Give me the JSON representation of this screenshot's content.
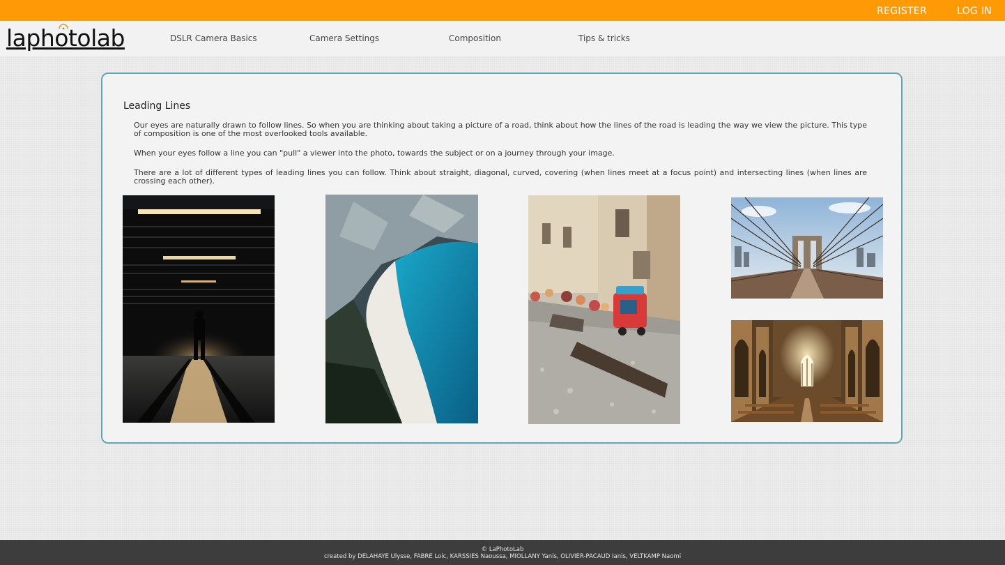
{
  "header": {
    "register_label": "REGISTER",
    "login_label": "LOG IN",
    "accent_color": "#ff9a05"
  },
  "nav": {
    "logo_text": "laphotolab",
    "items": [
      {
        "label": "DSLR Camera Basics"
      },
      {
        "label": "Camera Settings"
      },
      {
        "label": "Composition"
      },
      {
        "label": "Tips & tricks"
      }
    ]
  },
  "article": {
    "title": "Leading Lines",
    "paragraphs": [
      "Our eyes are naturally drawn to follow lines. So when you are thinking about taking a picture of a road, think about how the lines of the road is leading the way we view the picture. This type of composition is one of the most overlooked tools available.",
      "When your eyes follow a line you can \"pull\" a viewer into the photo, towards the subject or on a journey through your image.",
      "There are a lot of different types of leading lines you can follow. Think about straight, diagonal, curved, covering (when lines meet at a focus point) and intersecting lines (when lines are crossing each other)."
    ],
    "border_color": "#5fa7b6"
  },
  "gallery": [
    {
      "name": "parking-garage-silhouette-photo"
    },
    {
      "name": "beach-cliff-aerial-photo"
    },
    {
      "name": "street-toy-figures-photo"
    },
    {
      "name": "suspension-bridge-photo"
    },
    {
      "name": "cathedral-nave-photo"
    }
  ],
  "footer": {
    "copyright": "© LaPhotoLab",
    "credits": "created by DELAHAYE Ulysse, FABRE Loic, KARSSIES Naoussa, MIOLLANY Yanis, OLIVIER-PACAUD Ianis, VELTKAMP Naomi"
  }
}
